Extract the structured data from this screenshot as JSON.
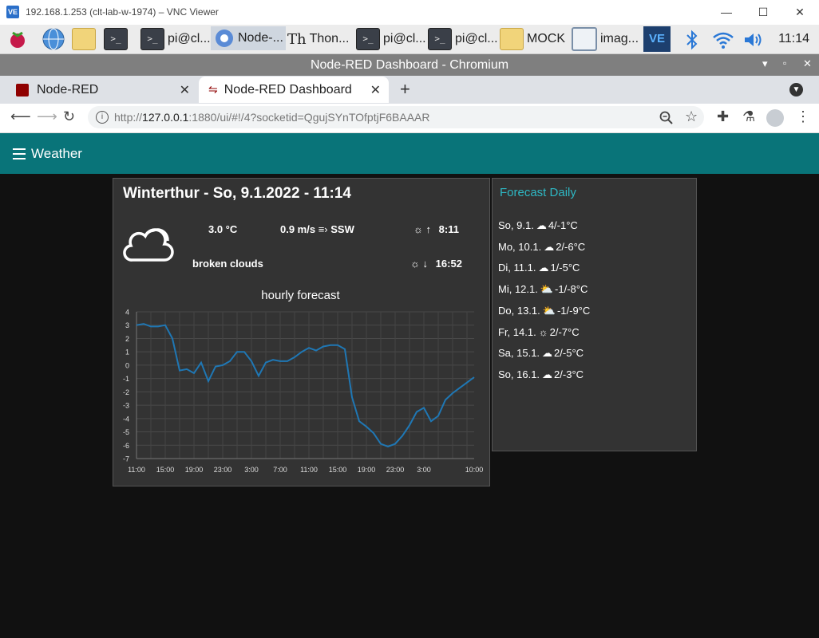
{
  "vnc": {
    "title": "192.168.1.253 (clt-lab-w-1974) – VNC Viewer",
    "logo": "VE",
    "minimize": "—",
    "maximize": "☐",
    "close": "✕"
  },
  "taskbar": {
    "items": [
      {
        "icon": "raspberry-icon"
      },
      {
        "icon": "globe-icon"
      },
      {
        "icon": "folders-icon"
      },
      {
        "icon": "terminal-icon"
      },
      {
        "icon": "terminal-icon",
        "label": "pi@cl..."
      },
      {
        "icon": "chromium-icon",
        "label": "Node-..."
      },
      {
        "icon": "thonny-icon",
        "label": "Thon..."
      },
      {
        "icon": "terminal-icon",
        "label": "pi@cl..."
      },
      {
        "icon": "terminal-icon",
        "label": "pi@cl..."
      },
      {
        "icon": "folder-icon",
        "label": "MOCK"
      },
      {
        "icon": "image-viewer-icon",
        "label": "imag..."
      }
    ],
    "vnc_tray": "VE",
    "clock": "11:14",
    "terminal_glyph": ">_"
  },
  "browser": {
    "window_title": "Node-RED Dashboard - Chromium",
    "tabs": [
      {
        "label": "Node-RED",
        "close": "✕"
      },
      {
        "label": "Node-RED Dashboard",
        "close": "✕"
      }
    ],
    "new_tab": "+",
    "url_prefix": "http://",
    "url_host": "127.0.0.1",
    "url_rest": ":1880/ui/#!/4?socketid=QgujSYnTOfptjF6BAAAR"
  },
  "dashboard": {
    "title": "Weather",
    "weather": {
      "heading": "Winterthur - So, 9.1.2022 - 11:14",
      "temperature": "3.0 °C",
      "wind": "0.9 m/s",
      "wind_dir": "SSW",
      "description": "broken clouds",
      "sunrise": "8:11",
      "sunset": "16:52"
    },
    "forecast": {
      "title": "Forecast Daily",
      "days": [
        {
          "label": "So, 9.1.",
          "icon": "rain-cloud-icon",
          "temps": "4/-1°C"
        },
        {
          "label": "Mo, 10.1.",
          "icon": "rain-cloud-icon",
          "temps": "2/-6°C"
        },
        {
          "label": "Di, 11.1.",
          "icon": "cloud-icon",
          "temps": "1/-5°C"
        },
        {
          "label": "Mi, 12.1.",
          "icon": "sun-cloud-icon",
          "temps": "-1/-8°C"
        },
        {
          "label": "Do, 13.1.",
          "icon": "sun-cloud-icon",
          "temps": "-1/-9°C"
        },
        {
          "label": "Fr, 14.1.",
          "icon": "sun-icon",
          "temps": "2/-7°C"
        },
        {
          "label": "Sa, 15.1.",
          "icon": "cloud-icon",
          "temps": "2/-5°C"
        },
        {
          "label": "So, 16.1.",
          "icon": "cloud-icon",
          "temps": "2/-3°C"
        }
      ]
    }
  },
  "chart_data": {
    "type": "line",
    "title": "hourly forecast",
    "xlabel": "",
    "ylabel": "",
    "ylim": [
      -7,
      4
    ],
    "yticks": [
      4,
      3,
      2,
      1,
      0,
      -1,
      -2,
      -3,
      -4,
      -5,
      -6,
      -7
    ],
    "xtick_labels": [
      "11:00",
      "15:00",
      "19:00",
      "23:00",
      "3:00",
      "7:00",
      "11:00",
      "15:00",
      "19:00",
      "23:00",
      "3:00",
      "10:00"
    ],
    "xtick_hours": [
      0,
      4,
      8,
      12,
      16,
      20,
      24,
      28,
      32,
      36,
      40,
      47
    ],
    "grid": true,
    "color": "#1f77b4",
    "series": [
      {
        "values": [
          3.0,
          3.1,
          2.9,
          2.9,
          3.0,
          2.0,
          -0.4,
          -0.3,
          -0.6,
          0.2,
          -1.2,
          -0.1,
          0.0,
          0.3,
          1.0,
          1.0,
          0.3,
          -0.8,
          0.2,
          0.4,
          0.3,
          0.3,
          0.6,
          1.0,
          1.3,
          1.1,
          1.4,
          1.5,
          1.5,
          1.2,
          -2.4,
          -4.2,
          -4.6,
          -5.1,
          -5.9,
          -6.1,
          -5.9,
          -5.3,
          -4.5,
          -3.5,
          -3.2,
          -4.2,
          -3.8,
          -2.6,
          -2.1,
          -1.7,
          -1.3,
          -0.9
        ]
      }
    ]
  }
}
